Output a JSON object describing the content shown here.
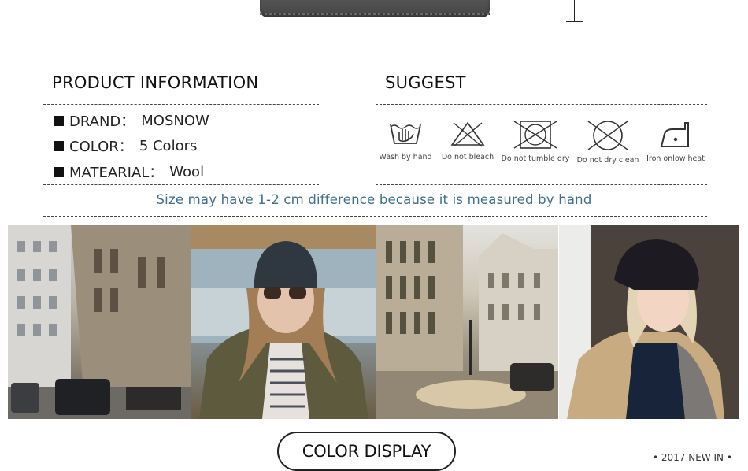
{
  "product_info": {
    "title": "PRODUCT INFORMATION",
    "rows": [
      {
        "label": "DRAND：",
        "value": "MOSNOW"
      },
      {
        "label": "COLOR：",
        "value": "5 Colors"
      },
      {
        "label": "MATEARIAL：",
        "value": "Wool"
      }
    ]
  },
  "suggest": {
    "title": "SUGGEST",
    "care_items": [
      {
        "icon": "wash-by-hand-icon",
        "label": "Wash by hand"
      },
      {
        "icon": "do-not-bleach-icon",
        "label": "Do not bleach"
      },
      {
        "icon": "do-not-tumble-dry-icon",
        "label": "Do not tumble dry"
      },
      {
        "icon": "do-not-dry-clean-icon",
        "label": "Do not dry clean"
      },
      {
        "icon": "iron-low-heat-icon",
        "label": "Iron onlow heat"
      }
    ]
  },
  "size_note": "Size may have 1-2 cm difference because it is measured by hand",
  "photos": [
    {
      "subject": "city-street-photo"
    },
    {
      "subject": "woman-sunglasses-beanie-photo"
    },
    {
      "subject": "city-buildings-photo"
    },
    {
      "subject": "smiling-woman-beanie-photo"
    }
  ],
  "color_display": "COLOR DISPLAY",
  "badge": "• 2017 NEW IN •",
  "colors": {
    "note_text": "#3f6e8e",
    "beanie": "#4a4a4a"
  }
}
